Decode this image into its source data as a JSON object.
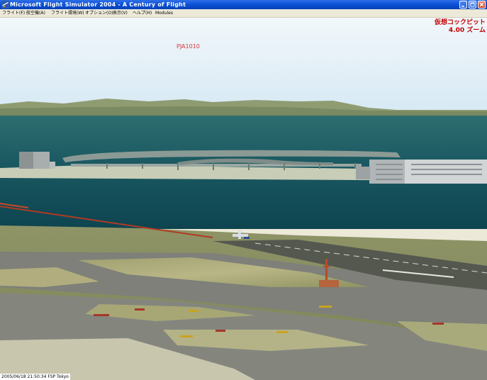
{
  "window": {
    "title": "Microsoft Flight Simulator 2004 - A Century of Flight"
  },
  "menu": [
    {
      "label": "フライト(F)"
    },
    {
      "label": "航空機(A)"
    },
    {
      "label": "フライト環境(W)"
    },
    {
      "label": "オプション(O)"
    },
    {
      "label": "表示(V)"
    },
    {
      "label": "ヘルプ(H)"
    },
    {
      "label": "Modules"
    }
  ],
  "hud": {
    "callsign": "PJA1010",
    "view_mode": "仮想コックピット",
    "zoom": "4.00 ズーム"
  },
  "status": {
    "text": "2005/06/18 21:50:34 FSP Tokyo"
  },
  "icons": {
    "app": "flight-sim-app-icon",
    "minimize": "minimize-icon",
    "maximize": "maximize-icon",
    "close": "close-icon"
  }
}
